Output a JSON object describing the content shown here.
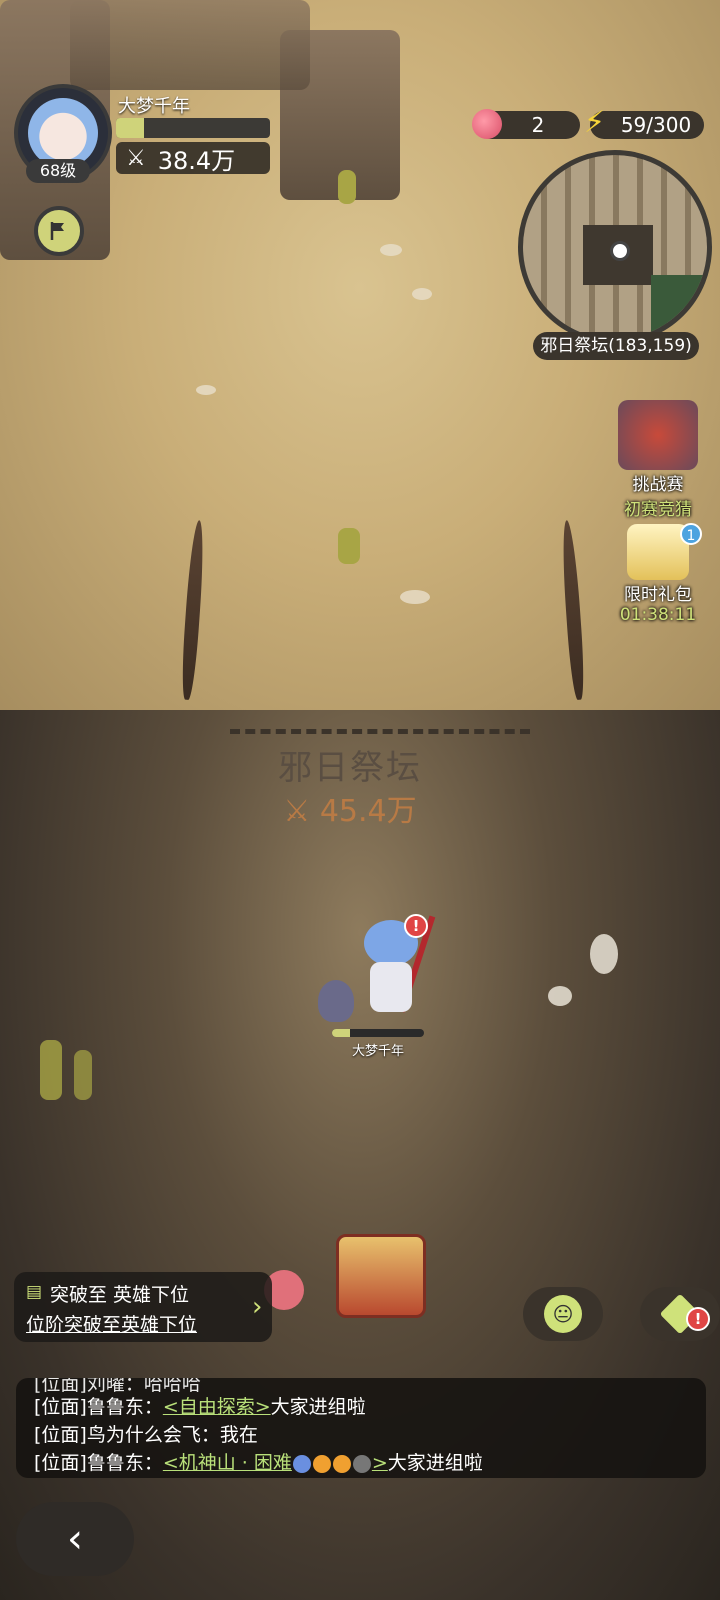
{
  "player": {
    "name": "大梦千年",
    "level": "68级",
    "xp_progress": 0.18,
    "power_icon": "crossed-swords-icon",
    "power": "38.4万"
  },
  "resources": {
    "peach": "2",
    "energy": "59/300"
  },
  "minimap": {
    "location": "邪日祭坛(183,159)"
  },
  "events": [
    {
      "title": "挑战赛",
      "subtitle": "初赛竞猜"
    },
    {
      "title": "限时礼包",
      "subtitle": "01:38:11",
      "badge": "1"
    }
  ],
  "zone": {
    "name": "邪日祭坛",
    "power": "45.4万"
  },
  "hero": {
    "name": "大梦千年",
    "hp_progress": 0.2,
    "alert": "!"
  },
  "quest": {
    "title": "突破至 英雄下位",
    "desc": "位阶突破至英雄下位",
    "arrow": "›"
  },
  "chat": {
    "partial": "[位面]刘曜：哈哈哈",
    "line1_prefix": "[位面]鲁鲁东：",
    "line1_link": "<自由探索>",
    "line1_suffix": "大家进组啦",
    "line2": "[位面]鸟为什么会飞：我在",
    "line3_prefix": "[位面]鲁鲁东：",
    "line3_link": "<机神山 · 困难",
    "line3_link_end": ">",
    "line3_suffix": "大家进组啦"
  },
  "buttons": {
    "back": "‹",
    "box_badge": "!"
  },
  "colors": {
    "accent": "#cfe27a",
    "power_orange": "#b87a45",
    "alert_red": "#e04545"
  }
}
